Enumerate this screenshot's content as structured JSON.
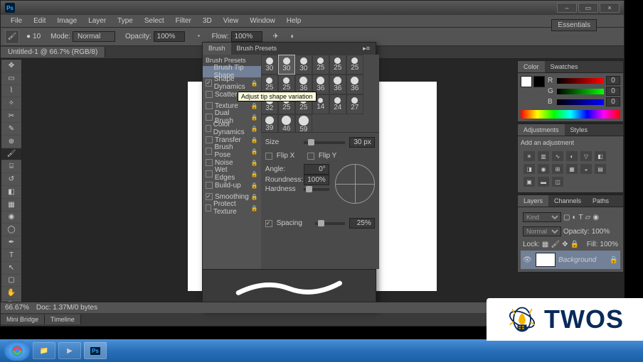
{
  "titlebar": {
    "app": "Ps"
  },
  "menu": [
    "File",
    "Edit",
    "Image",
    "Layer",
    "Type",
    "Select",
    "Filter",
    "3D",
    "View",
    "Window",
    "Help"
  ],
  "options": {
    "brush_size": "10",
    "mode_label": "Mode:",
    "mode_value": "Normal",
    "opacity_label": "Opacity:",
    "opacity_value": "100%",
    "flow_label": "Flow:",
    "flow_value": "100%"
  },
  "workspace_preset": "Essentials",
  "doc_tab": "Untitled-1 @ 66.7% (RGB/8)",
  "status": {
    "zoom": "66.67%",
    "doc": "Doc: 1.37M/0 bytes"
  },
  "bottom_tabs": [
    "Mini Bridge",
    "Timeline"
  ],
  "brush_panel": {
    "tabs": [
      "Brush",
      "Brush Presets"
    ],
    "header": "Brush Presets",
    "rows": [
      {
        "label": "Brush Tip Shape",
        "checked": null,
        "lock": false,
        "active": true
      },
      {
        "label": "Shape Dynamics",
        "checked": true,
        "lock": true
      },
      {
        "label": "Scattering",
        "checked": false,
        "lock": true
      },
      {
        "label": "Texture",
        "checked": false,
        "lock": true
      },
      {
        "label": "Dual Brush",
        "checked": false,
        "lock": true
      },
      {
        "label": "Color Dynamics",
        "checked": false,
        "lock": true
      },
      {
        "label": "Transfer",
        "checked": false,
        "lock": true
      },
      {
        "label": "Brush Pose",
        "checked": false,
        "lock": true
      },
      {
        "label": "Noise",
        "checked": false,
        "lock": true
      },
      {
        "label": "Wet Edges",
        "checked": false,
        "lock": true
      },
      {
        "label": "Build-up",
        "checked": false,
        "lock": true
      },
      {
        "label": "Smoothing",
        "checked": true,
        "lock": true
      },
      {
        "label": "Protect Texture",
        "checked": false,
        "lock": true
      }
    ],
    "tooltip": "Adjust tip shape variation",
    "brush_sizes": [
      30,
      30,
      30,
      25,
      25,
      25,
      25,
      25,
      36,
      36,
      36,
      36,
      32,
      25,
      25,
      14,
      24,
      27,
      39,
      46,
      59
    ],
    "size_label": "Size",
    "size_value": "30 px",
    "flipx": "Flip X",
    "flipy": "Flip Y",
    "angle_label": "Angle:",
    "angle_value": "0°",
    "round_label": "Roundness:",
    "round_value": "100%",
    "hard_label": "Hardness",
    "spacing_label": "Spacing",
    "spacing_value": "25%"
  },
  "color_panel": {
    "tabs": [
      "Color",
      "Swatches"
    ],
    "r": "0",
    "g": "0",
    "b": "0"
  },
  "adjust_panel": {
    "tabs": [
      "Adjustments",
      "Styles"
    ],
    "heading": "Add an adjustment"
  },
  "layers_panel": {
    "tabs": [
      "Layers",
      "Channels",
      "Paths"
    ],
    "kind": "Kind",
    "blend_mode": "Normal",
    "opacity_label": "Opacity:",
    "opacity_value": "100%",
    "lock_label": "Lock:",
    "fill_label": "Fill:",
    "fill_value": "100%",
    "layer_name": "Background"
  },
  "twos": "TWOS"
}
